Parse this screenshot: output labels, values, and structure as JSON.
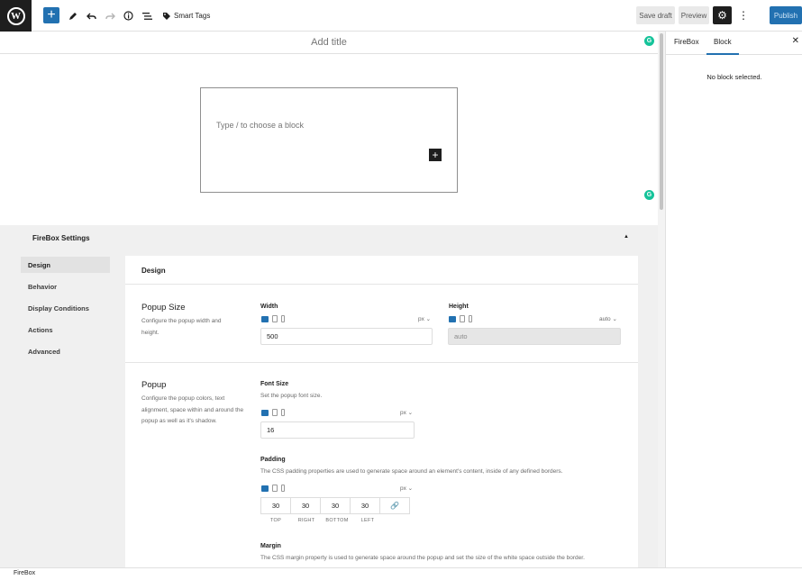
{
  "toolbar": {
    "add_icon": "plus-icon",
    "tools": [
      "pencil-icon",
      "undo-icon",
      "redo-icon",
      "info-icon",
      "list-view-icon"
    ],
    "smart_tags_label": "Smart Tags",
    "save_draft_label": "Save draft",
    "preview_label": "Preview",
    "publish_label": "Publish"
  },
  "editor": {
    "title_placeholder": "Add title",
    "block_placeholder": "Type / to choose a block"
  },
  "sidebar": {
    "tabs": [
      "FireBox",
      "Block"
    ],
    "active_tab": "Block",
    "empty_message": "No block selected."
  },
  "firebox": {
    "title": "FireBox Settings",
    "nav": [
      "Design",
      "Behavior",
      "Display Conditions",
      "Actions",
      "Advanced"
    ],
    "active_nav": "Design",
    "panel_title": "Design",
    "popup_size": {
      "title": "Popup Size",
      "description": "Configure the popup width and height.",
      "width_label": "Width",
      "width_unit": "px",
      "width_value": "500",
      "height_label": "Height",
      "height_unit": "auto",
      "height_value": "auto"
    },
    "popup": {
      "title": "Popup",
      "description": "Configure the popup colors, text alignment, space within and around the popup as well as it's shadow.",
      "font_size_label": "Font Size",
      "font_size_help": "Set the popup font size.",
      "font_size_unit": "px",
      "font_size_value": "16",
      "padding_label": "Padding",
      "padding_help": "The CSS padding properties are used to generate space around an element's content, inside of any defined borders.",
      "padding_unit": "px",
      "padding_values": [
        "30",
        "30",
        "30",
        "30"
      ],
      "padding_sides": [
        "TOP",
        "RIGHT",
        "BOTTOM",
        "LEFT"
      ],
      "margin_label": "Margin",
      "margin_help": "The CSS margin property is used to generate space around the popup and set the size of the white space outside the border."
    }
  },
  "footer": {
    "breadcrumb": "FireBox"
  },
  "colors": {
    "accent": "#2271b1",
    "grammarly": "#15c39a",
    "dark": "#1e1e1e"
  }
}
